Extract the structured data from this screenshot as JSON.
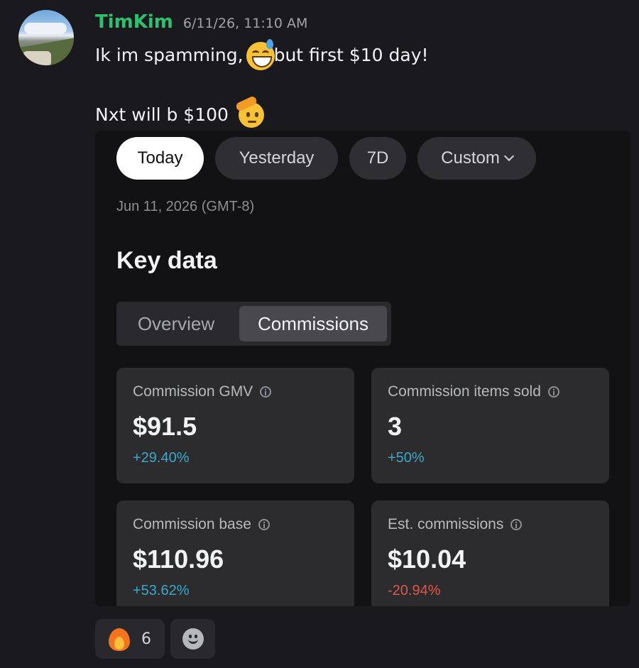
{
  "message": {
    "username": "TimKim",
    "timestamp": "6/11/26, 11:10 AM",
    "line1_before": "Ik im spamming,",
    "line1_after": "but first $10 day!",
    "line2": "Nxt will b $100",
    "emojis": [
      "sweat-smile-emoji",
      "saluting-face-emoji"
    ]
  },
  "embed": {
    "filters": [
      {
        "label": "Today",
        "active": true
      },
      {
        "label": "Yesterday",
        "active": false
      },
      {
        "label": "7D",
        "active": false
      },
      {
        "label": "Custom",
        "active": false
      }
    ],
    "date": "Jun 11, 2026 (GMT-8)",
    "title": "Key data",
    "tabs": {
      "overview": "Overview",
      "commissions": "Commissions",
      "selected": "Commissions"
    },
    "cards": [
      {
        "label": "Commission GMV",
        "value": "$91.5",
        "change": "+29.40%",
        "trend": "up"
      },
      {
        "label": "Commission items sold",
        "value": "3",
        "change": "+50%",
        "trend": "up"
      },
      {
        "label": "Commission base",
        "value": "$110.96",
        "change": "+53.62%",
        "trend": "up"
      },
      {
        "label": "Est. commissions",
        "value": "$10.04",
        "change": "-20.94%",
        "trend": "down"
      }
    ]
  },
  "reactions": [
    {
      "icon": "fire-icon",
      "count": "6"
    }
  ],
  "colors": {
    "username": "#2fbf71",
    "positive": "#3ea7c8",
    "negative": "#e0574a",
    "background": "#1a1a1e"
  }
}
